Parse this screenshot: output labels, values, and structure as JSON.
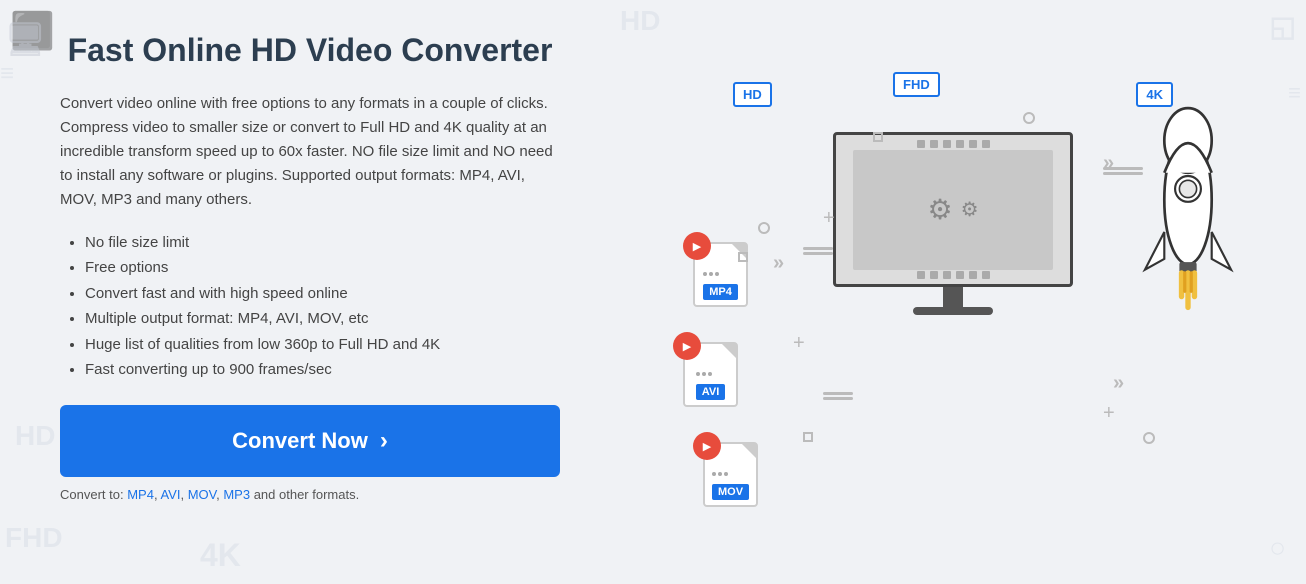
{
  "title": "Fast Online HD Video Converter",
  "description": "Convert video online with free options to any formats in a couple of clicks. Compress video to smaller size or convert to Full HD and 4K quality at an incredible transform speed up to 60x faster. NO file size limit and NO need to install any software or plugins. Supported output formats: MP4, AVI, MOV, MP3 and many others.",
  "features": [
    "No file size limit",
    "Free options",
    "Convert fast and with high speed online",
    "Multiple output format: MP4, AVI, MOV, etc",
    "Huge list of qualities from low 360p to Full HD and 4K",
    "Fast converting up to 900 frames/sec"
  ],
  "convert_btn_label": "Convert Now",
  "convert_btn_arrow": "›",
  "formats_prefix": "Convert to: ",
  "formats": [
    {
      "label": "MP4",
      "href": "#"
    },
    {
      "label": "AVI",
      "href": "#"
    },
    {
      "label": "MOV",
      "href": "#"
    },
    {
      "label": "MP3",
      "href": "#"
    }
  ],
  "formats_suffix": " and other formats.",
  "badges": [
    "HD",
    "FHD",
    "4K"
  ],
  "file_formats": [
    "MP4",
    "AVI",
    "MOV"
  ],
  "illustration": {
    "badge_hd": "HD",
    "badge_fhd": "FHD",
    "badge_4k": "4K"
  }
}
